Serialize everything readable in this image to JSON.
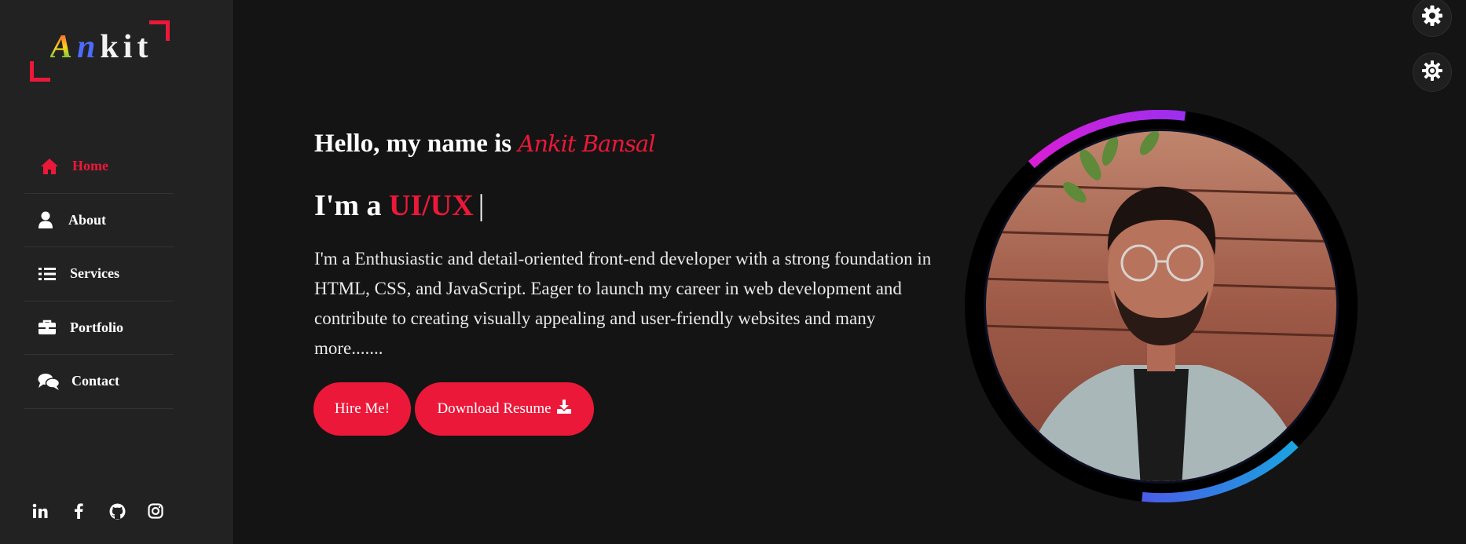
{
  "logo": {
    "l1": "A",
    "l2": "n",
    "l3": "kit"
  },
  "nav": [
    {
      "label": "Home",
      "icon": "home-icon",
      "active": true
    },
    {
      "label": "About",
      "icon": "user-icon",
      "active": false
    },
    {
      "label": "Services",
      "icon": "list-icon",
      "active": false
    },
    {
      "label": "Portfolio",
      "icon": "briefcase-icon",
      "active": false
    },
    {
      "label": "Contact",
      "icon": "comments-icon",
      "active": false
    }
  ],
  "socials": [
    "linkedin-icon",
    "facebook-icon",
    "github-icon",
    "instagram-icon"
  ],
  "hero": {
    "hello_prefix": "Hello, my name is ",
    "name": "Ankit Bansal",
    "iam_prefix": "I'm a ",
    "role": "UI/UX",
    "cursor": "|",
    "bio": "I'm a Enthusiastic and detail-oriented front-end developer with a strong foundation in HTML, CSS, and JavaScript. Eager to launch my career in web development and contribute to creating visually appealing and user-friendly websites and many more.......",
    "hire_label": "Hire Me!",
    "download_label": "Download Resume"
  },
  "colors": {
    "accent": "#ec1839",
    "sidebar": "#222222",
    "background": "#141414",
    "ring_purple": "#c01ce8",
    "ring_blue": "#2a8ce6"
  }
}
